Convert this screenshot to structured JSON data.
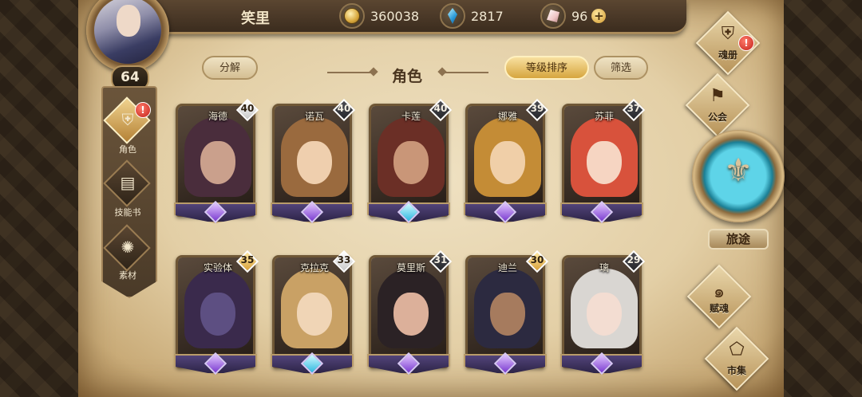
{
  "player": {
    "name": "笑里",
    "level": "64"
  },
  "resources": [
    {
      "icon": "gold-coin-icon",
      "value": "360038"
    },
    {
      "icon": "blue-gem-icon",
      "value": "2817"
    },
    {
      "icon": "pink-crystal-icon",
      "value": "96",
      "add": "+"
    }
  ],
  "header": {
    "title": "角色",
    "decompose_label": "分解",
    "sort_label": "等级排序",
    "filter_label": "筛选"
  },
  "left_nav": [
    {
      "label": "角色",
      "icon": "helmet-icon",
      "active": true,
      "alert": "!"
    },
    {
      "label": "技能书",
      "icon": "book-icon",
      "active": false
    },
    {
      "label": "素材",
      "icon": "material-icon",
      "active": false
    }
  ],
  "characters": [
    {
      "name": "海德",
      "level": "40",
      "level_style": "silver",
      "gem": "purple"
    },
    {
      "name": "诺瓦",
      "level": "40",
      "level_style": "dark",
      "gem": "purple"
    },
    {
      "name": "卡莲",
      "level": "40",
      "level_style": "dark",
      "gem": "blue"
    },
    {
      "name": "娜雅",
      "level": "39",
      "level_style": "dark",
      "gem": "purple"
    },
    {
      "name": "苏菲",
      "level": "37",
      "level_style": "dark",
      "gem": "purple"
    },
    {
      "name": "实验体",
      "level": "35",
      "level_style": "gold",
      "gem": "purple"
    },
    {
      "name": "克拉克",
      "level": "33",
      "level_style": "silver",
      "gem": "blue"
    },
    {
      "name": "莫里斯",
      "level": "31",
      "level_style": "dark",
      "gem": "purple"
    },
    {
      "name": "迪兰",
      "level": "30",
      "level_style": "gold",
      "gem": "purple"
    },
    {
      "name": "璃",
      "level": "29",
      "level_style": "dark",
      "gem": "purple"
    }
  ],
  "right_nav": {
    "soul_book": {
      "label": "魂册",
      "alert": "!"
    },
    "guild": {
      "label": "公会"
    },
    "journey": {
      "label": "旅途"
    },
    "talent_soul": {
      "label": "赋魂"
    },
    "market": {
      "label": "市集"
    }
  }
}
